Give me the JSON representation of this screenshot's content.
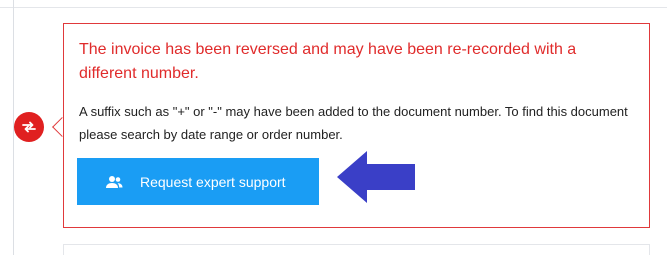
{
  "alert": {
    "title": "The invoice has been reversed and may have been re-recorded with a different number.",
    "body": "A suffix such as \"+\" or \"-\" may have been added to the document number. To find this document please search by date range or order number.",
    "button_label": "Request expert support"
  },
  "icons": {
    "marker": "reverse-arrows-icon",
    "button": "users-icon",
    "annotation": "left-arrow-icon"
  },
  "colors": {
    "alert_red": "#e02b2b",
    "button_blue": "#1a9df4",
    "annotation_arrow": "#3a3fc7"
  }
}
